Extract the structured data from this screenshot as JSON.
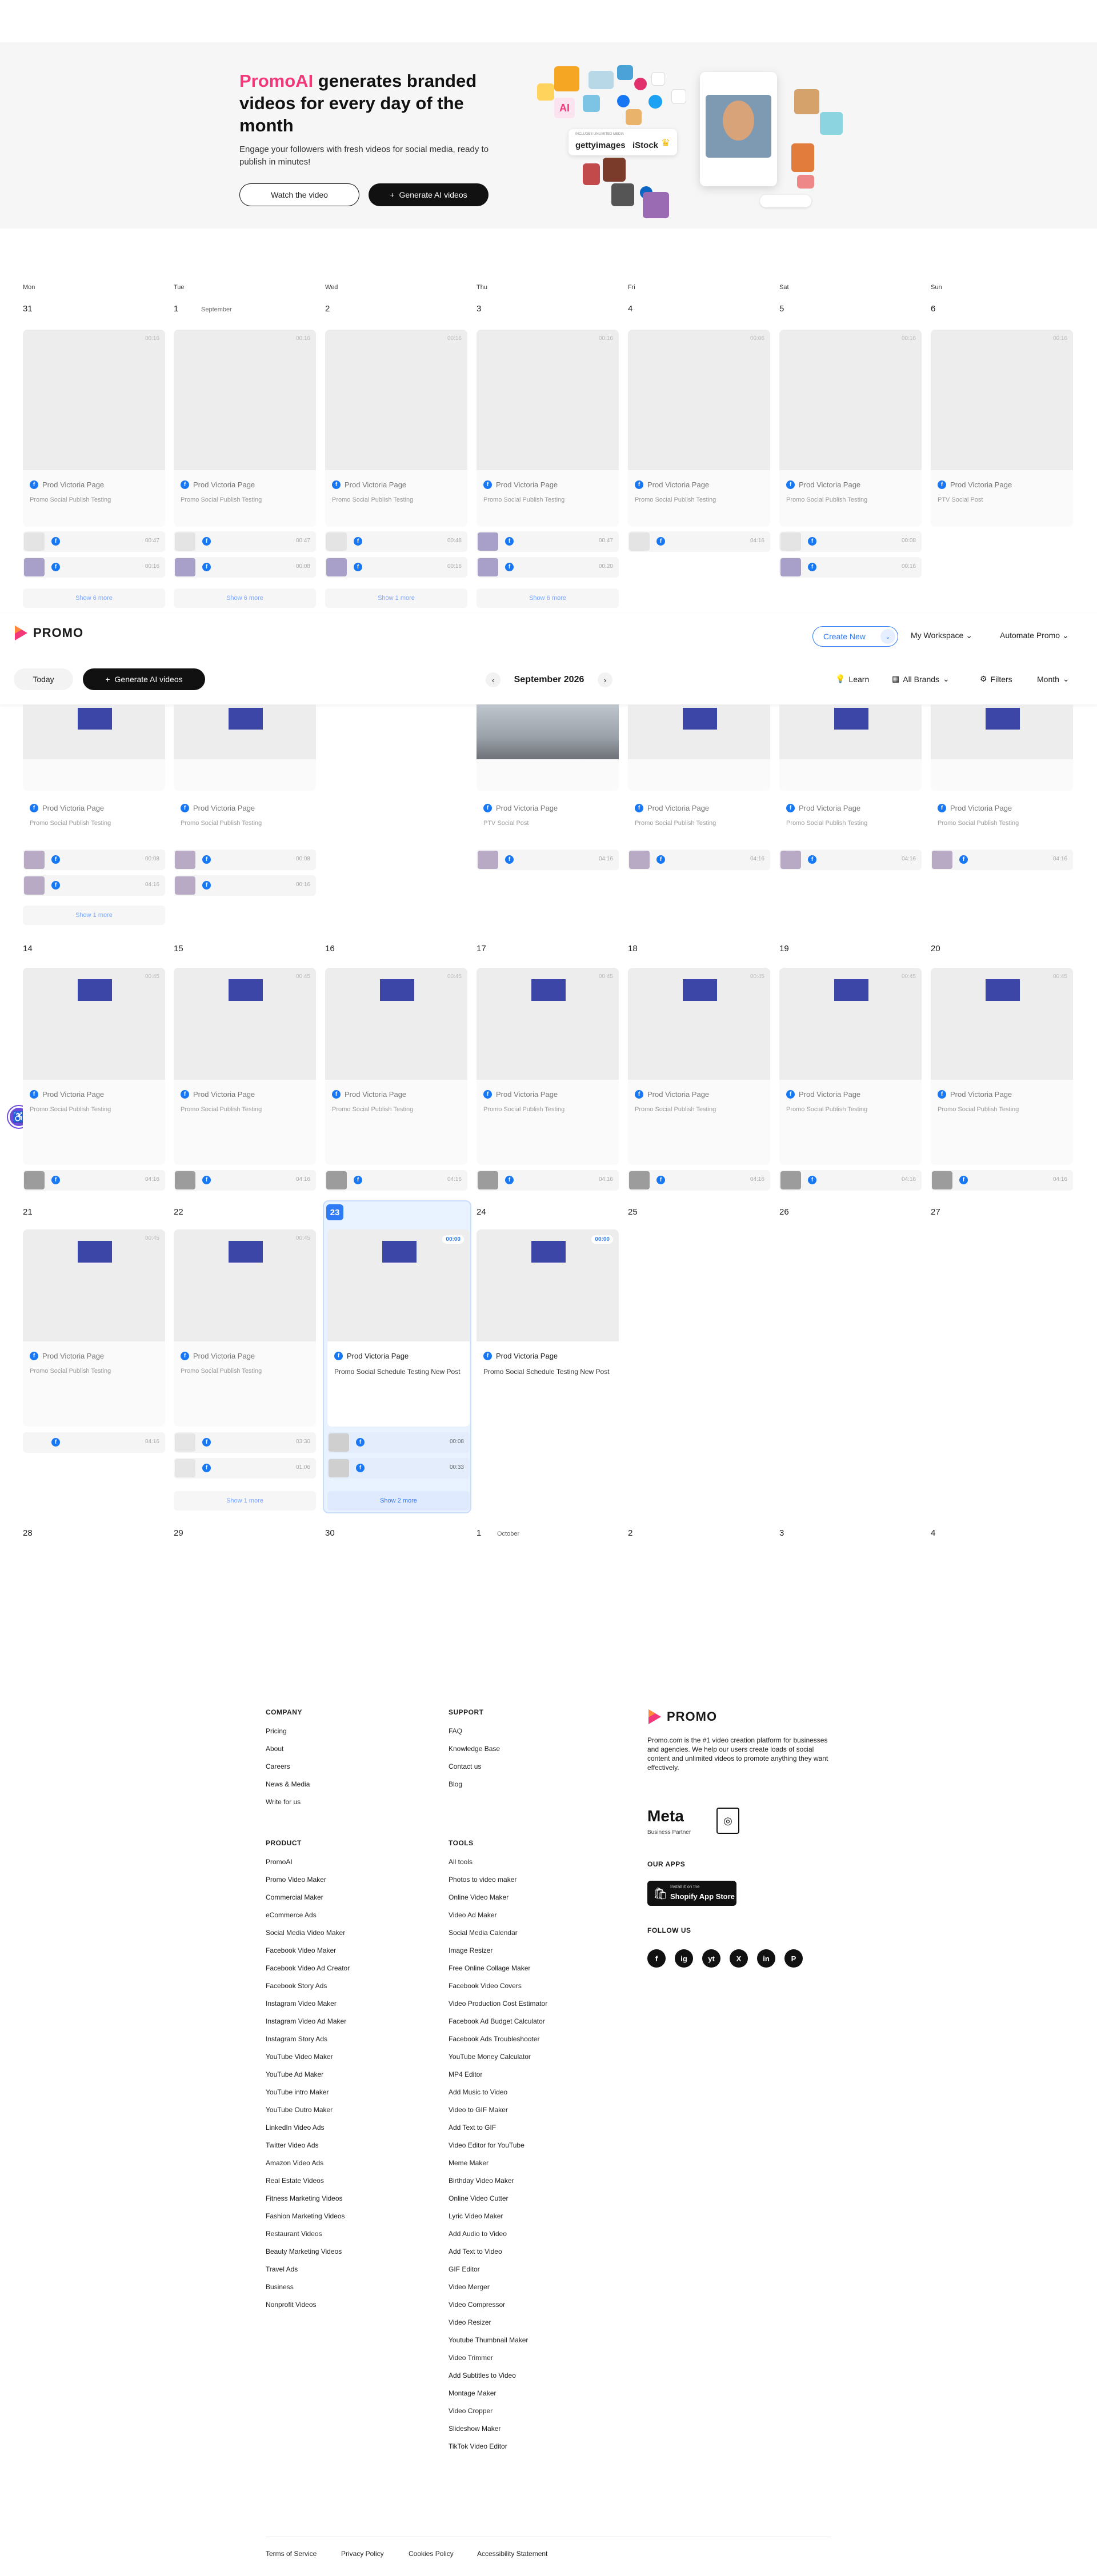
{
  "hero": {
    "title_accent": "PromoAI",
    "title_rest": " generates branded videos for every day of the month",
    "subtitle": "Engage your followers with fresh videos for social media, ready to publish in minutes!",
    "watch_label": "Watch the video",
    "generate_label": "Generate AI videos",
    "collage_line1": "INCLUDES UNLIMITED MEDIA",
    "collage_getty": "gettyimages",
    "collage_istock": "iStock",
    "collage_ai": "AI"
  },
  "weekdays": [
    "Mon",
    "Tue",
    "Wed",
    "Thu",
    "Fri",
    "Sat",
    "Sun"
  ],
  "week1": {
    "days": [
      "31",
      "1",
      "2",
      "3",
      "4",
      "5",
      "6"
    ],
    "month_label": "September",
    "cards": [
      {
        "page": "Prod Victoria Page",
        "sub": "Promo Social Publish Testing",
        "dur": "00:16"
      },
      {
        "page": "Prod Victoria Page",
        "sub": "Promo Social Publish Testing",
        "dur": "00:16"
      },
      {
        "page": "Prod Victoria Page",
        "sub": "Promo Social Publish Testing",
        "dur": "00:16"
      },
      {
        "page": "Prod Victoria Page",
        "sub": "Promo Social Publish Testing",
        "dur": "00:16"
      },
      {
        "page": "Prod Victoria Page",
        "sub": "Promo Social Publish Testing",
        "dur": "00:06"
      },
      {
        "page": "Prod Victoria Page",
        "sub": "Promo Social Publish Testing",
        "dur": "00:16"
      },
      {
        "page": "Prod Victoria Page",
        "sub": "PTV Social Post",
        "dur": "00:16"
      }
    ],
    "mini_times": [
      [
        "00:47",
        "00:16"
      ],
      [
        "00:47",
        "00:08"
      ],
      [
        "00:48",
        "00:16"
      ],
      [
        "00:47",
        "00:20"
      ],
      [
        "04:16"
      ],
      [
        "00:08",
        "00:16"
      ],
      []
    ],
    "show_more": [
      "Show 6 more",
      "Show 6 more",
      "Show 1 more",
      "Show 6 more"
    ]
  },
  "toolbar": {
    "logo": "PROMO",
    "create_new": "Create New",
    "workspace": "My Workspace",
    "automate": "Automate Promo",
    "today": "Today",
    "generate": "Generate AI videos",
    "month_title": "September 2026",
    "learn": "Learn",
    "brands": "All Brands",
    "filters": "Filters",
    "view": "Month"
  },
  "week2": {
    "cards": [
      {
        "page": "Prod Victoria Page",
        "sub": "Promo Social Publish Testing"
      },
      {
        "page": "Prod Victoria Page",
        "sub": "Promo Social Publish Testing"
      },
      {
        "page": "Prod Victoria Page",
        "sub": "PTV Social Post"
      },
      {
        "page": "Prod Victoria Page",
        "sub": "Promo Social Publish Testing"
      },
      {
        "page": "Prod Victoria Page",
        "sub": "Promo Social Publish Testing"
      },
      {
        "page": "Prod Victoria Page",
        "sub": "Promo Social Publish Testing"
      }
    ],
    "mini_times": [
      [
        "00:08",
        "04:16"
      ],
      [
        "00:08",
        "00:16"
      ],
      [
        "04:16"
      ],
      [
        "04:16"
      ],
      [
        "04:16"
      ]
    ],
    "show_more": "Show 1 more"
  },
  "week3": {
    "days": [
      "14",
      "15",
      "16",
      "17",
      "18",
      "19",
      "20"
    ],
    "durs": [
      "00:45",
      "00:45",
      "00:45",
      "00:45",
      "00:45",
      "00:45",
      "00:45"
    ],
    "page": "Prod Victoria Page",
    "sub": "Promo Social Publish Testing",
    "mini_time": "04:16"
  },
  "week4": {
    "days": [
      "21",
      "22",
      "23",
      "24",
      "25",
      "26",
      "27"
    ],
    "cards": [
      {
        "page": "Prod Victoria Page",
        "sub": "Promo Social Publish Testing",
        "dur": "00:45"
      },
      {
        "page": "Prod Victoria Page",
        "sub": "Promo Social Publish Testing",
        "dur": "00:45"
      },
      {
        "page": "Prod Victoria Page",
        "sub": "Promo Social Schedule Testing New Post",
        "dur": "00:00"
      },
      {
        "page": "Prod Victoria Page",
        "sub": "Promo Social Schedule Testing New Post",
        "dur": "00:00"
      }
    ],
    "mini_times": [
      [
        "04:16"
      ],
      [
        "03:30",
        "01:06"
      ],
      [
        "00:08",
        "00:33"
      ]
    ],
    "show_more": [
      "Show 1 more",
      "Show 2 more"
    ]
  },
  "week5": {
    "days": [
      "28",
      "29",
      "30",
      "1",
      "2",
      "3",
      "4"
    ],
    "month_label": "October"
  },
  "footer": {
    "company_title": "COMPANY",
    "company": [
      "Pricing",
      "About",
      "Careers",
      "News & Media",
      "Write for us"
    ],
    "support_title": "SUPPORT",
    "support": [
      "FAQ",
      "Knowledge Base",
      "Contact us",
      "Blog"
    ],
    "product_title": "PRODUCT",
    "product": [
      "PromoAI",
      "Promo Video Maker",
      "Commercial Maker",
      "eCommerce Ads",
      "Social Media Video Maker",
      "Facebook Video Maker",
      "Facebook Video Ad Creator",
      "Facebook Story Ads",
      "Instagram Video Maker",
      "Instagram Video Ad Maker",
      "Instagram Story Ads",
      "YouTube Video Maker",
      "YouTube Ad Maker",
      "YouTube intro Maker",
      "YouTube Outro Maker",
      "LinkedIn Video Ads",
      "Twitter Video Ads",
      "Amazon Video Ads",
      "Real Estate Videos",
      "Fitness Marketing Videos",
      "Fashion Marketing Videos",
      "Restaurant Videos",
      "Beauty Marketing Videos",
      "Travel Ads",
      "Business",
      "Nonprofit Videos"
    ],
    "tools_title": "TOOLS",
    "tools": [
      "All tools",
      "Photos to video maker",
      "Online Video Maker",
      "Video Ad Maker",
      "Social Media Calendar",
      "Image Resizer",
      "Free Online Collage Maker",
      "Facebook Video Covers",
      "Video Production Cost Estimator",
      "Facebook Ad Budget Calculator",
      "Facebook Ads Troubleshooter",
      "YouTube Money Calculator",
      "MP4 Editor",
      "Add Music to Video",
      "Video to GIF Maker",
      "Add Text to GIF",
      "Video Editor for YouTube",
      "Meme Maker",
      "Birthday Video Maker",
      "Online Video Cutter",
      "Lyric Video Maker",
      "Add Audio to Video",
      "Add Text to Video",
      "GIF Editor",
      "Video Merger",
      "Video Compressor",
      "Video Resizer",
      "Youtube Thumbnail Maker",
      "Video Trimmer",
      "Add Subtitles to Video",
      "Montage Maker",
      "Video Cropper",
      "Slideshow Maker",
      "TikTok Video Editor"
    ],
    "logo": "PROMO",
    "desc": "Promo.com is the #1 video creation platform for businesses and agencies. We help our users create loads of social content and unlimited videos to promote anything they want effectively.",
    "meta": "Meta",
    "meta_sub": "Business Partner",
    "apps_title": "OUR APPS",
    "store_small": "Install it on the",
    "store": "Shopify App Store",
    "follow_title": "FOLLOW US",
    "social": [
      "f",
      "ig",
      "yt",
      "X",
      "in",
      "P"
    ],
    "legal": [
      "Terms of Service",
      "Privacy Policy",
      "Cookies Policy",
      "Accessibility Statement"
    ]
  },
  "colors": {
    "accent": "#2f7bf5",
    "brand_pink": "#f2387a",
    "facebook": "#1877f2"
  }
}
